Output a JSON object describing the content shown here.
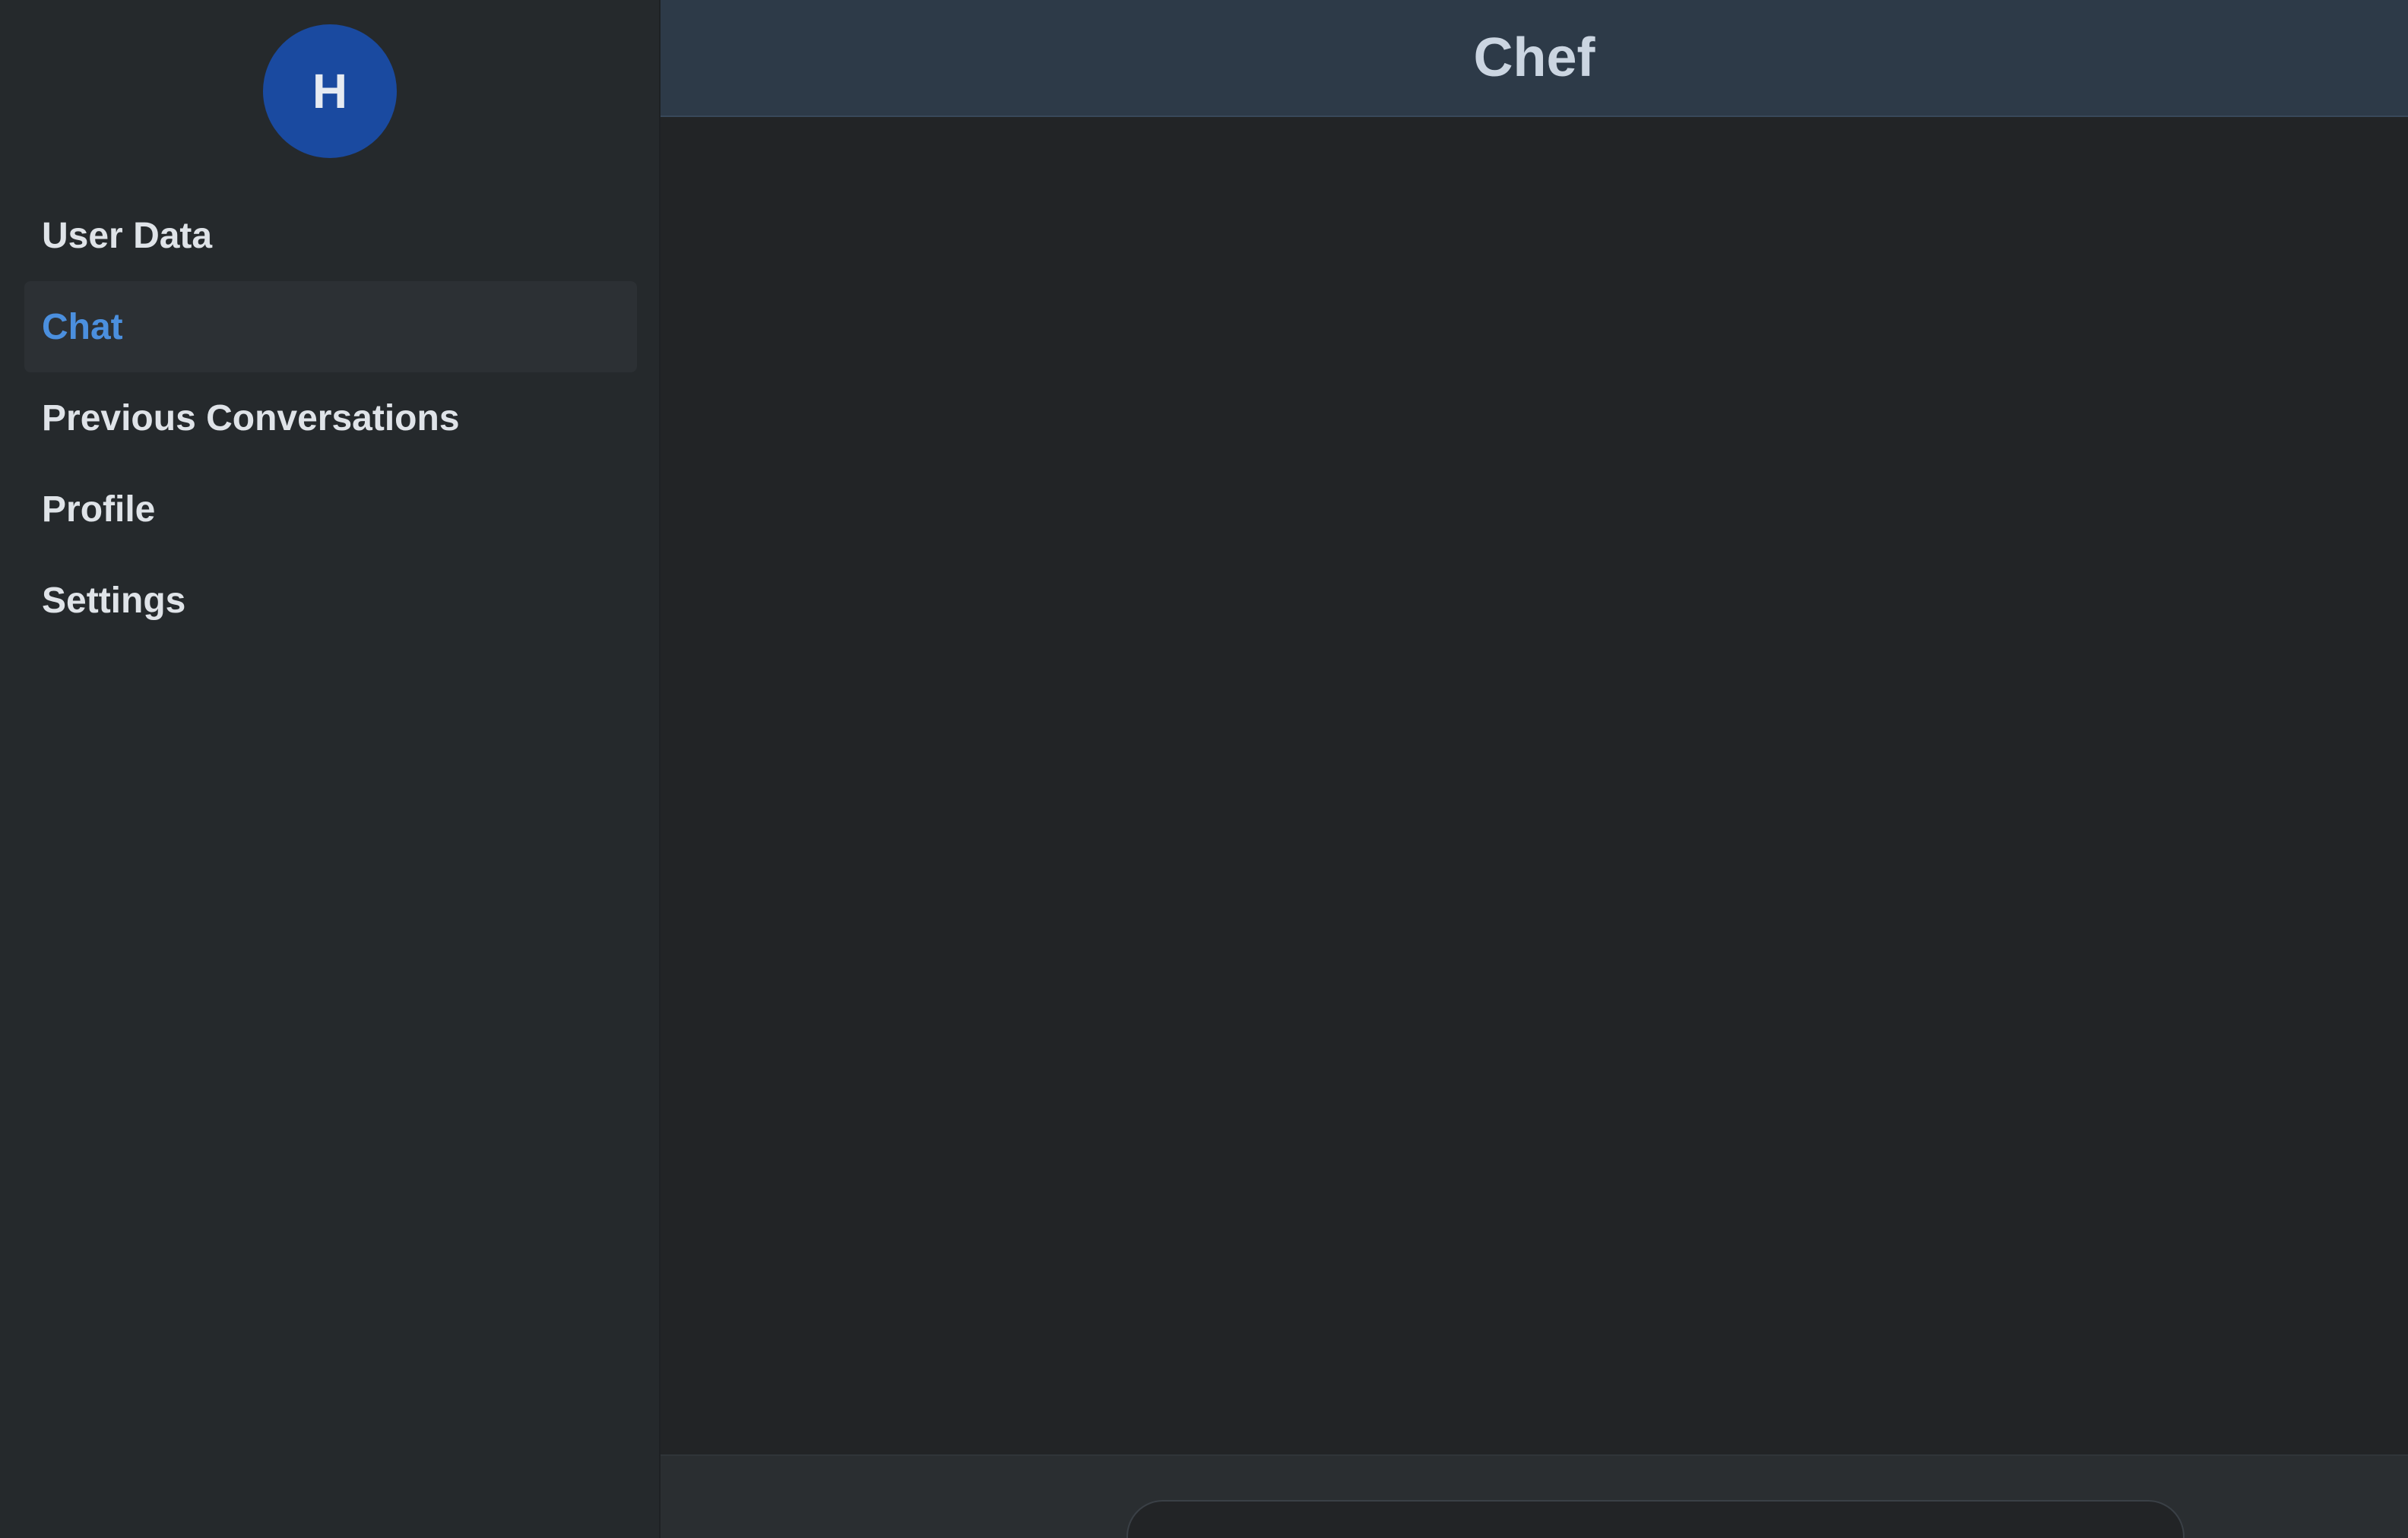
{
  "sidebar": {
    "avatar_initial": "H",
    "items": [
      {
        "label": "User Data",
        "active": false
      },
      {
        "label": "Chat",
        "active": true
      },
      {
        "label": "Previous Conversations",
        "active": false
      },
      {
        "label": "Profile",
        "active": false
      },
      {
        "label": "Settings",
        "active": false
      }
    ]
  },
  "header": {
    "title": "Chef"
  },
  "composer": {
    "value": ""
  },
  "colors": {
    "sidebar_bg": "#25292c",
    "header_bg": "#2d3a48",
    "avatar_bg": "#1a4aa0",
    "active_text": "#4b8fde",
    "text": "#dfe3e8"
  }
}
